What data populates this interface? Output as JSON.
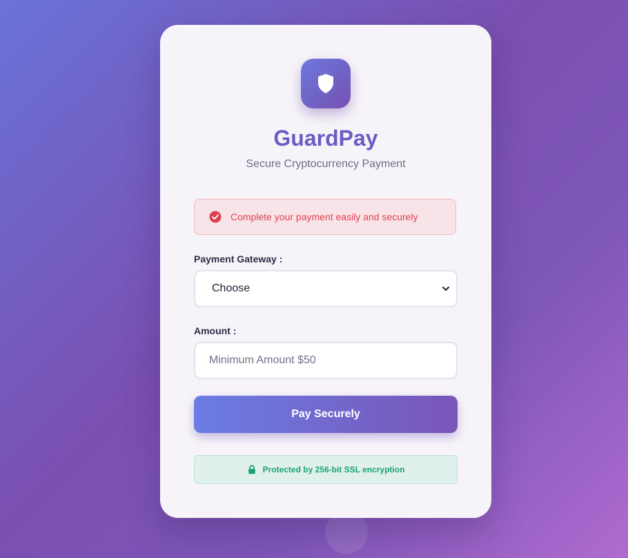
{
  "app": {
    "name": "GuardPay",
    "tagline": "Secure Cryptocurrency Payment",
    "logo_icon": "shield-icon"
  },
  "alert": {
    "icon": "check-circle-icon",
    "text": "Complete your payment easily and securely",
    "color": "#e0414f"
  },
  "form": {
    "gateway": {
      "label": "Payment Gateway :",
      "selected": "Choose"
    },
    "amount": {
      "label": "Amount :",
      "placeholder": "Minimum Amount $50",
      "value": ""
    },
    "submit_label": "Pay Securely"
  },
  "security_note": {
    "icon": "lock-icon",
    "text": "Protected by 256-bit SSL encryption",
    "color": "#1aa36e"
  },
  "colors": {
    "accent": "#6b5cc4",
    "button_start": "#6a7de4",
    "button_end": "#7a55b8"
  }
}
